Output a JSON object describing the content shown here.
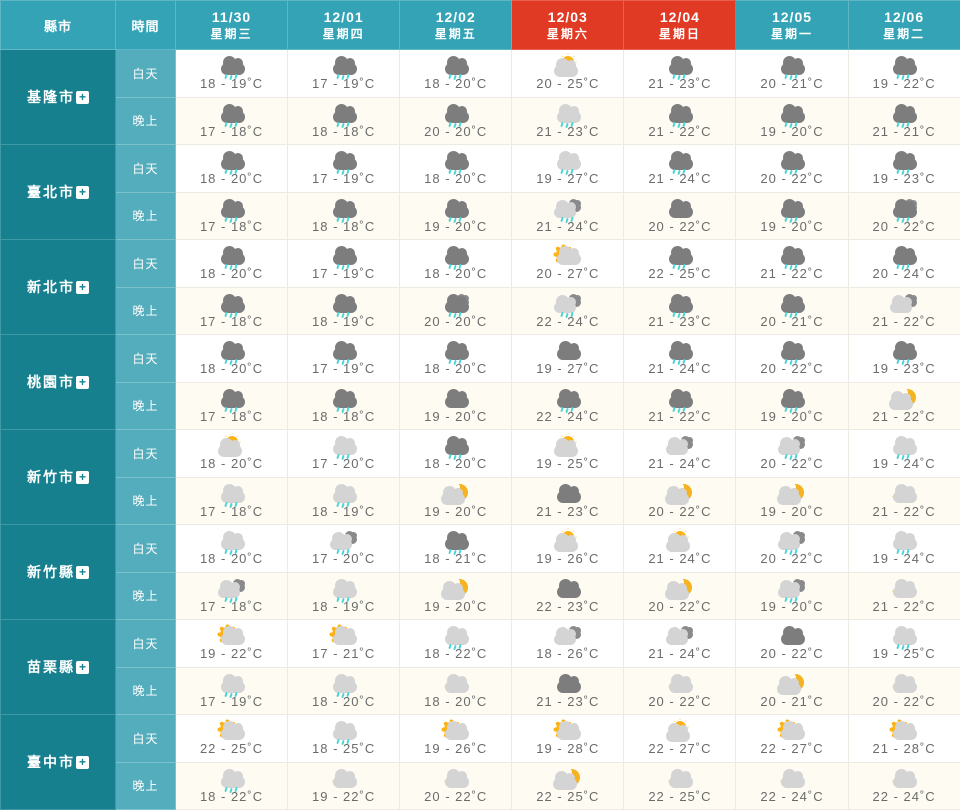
{
  "colors": {
    "header_teal": "#35a3b6",
    "weekend_red": "#e03a25",
    "city_teal": "#17808f",
    "time_teal": "#54adbc",
    "night_row_bg": "#fdfbf2",
    "temp_text": "#6b6b6b",
    "rain_blue": "#4fd3d9",
    "sun_orange": "#fbb315",
    "moon_orange": "#f5b221"
  },
  "header": {
    "city_label": "縣市",
    "time_label": "時間",
    "days": [
      {
        "date": "11/30",
        "dow": "星期三",
        "weekend": false
      },
      {
        "date": "12/01",
        "dow": "星期四",
        "weekend": false
      },
      {
        "date": "12/02",
        "dow": "星期五",
        "weekend": false
      },
      {
        "date": "12/03",
        "dow": "星期六",
        "weekend": true
      },
      {
        "date": "12/04",
        "dow": "星期日",
        "weekend": true
      },
      {
        "date": "12/05",
        "dow": "星期一",
        "weekend": false
      },
      {
        "date": "12/06",
        "dow": "星期二",
        "weekend": false
      }
    ]
  },
  "labels": {
    "day": "白天",
    "night": "晚上",
    "expand_icon": "+"
  },
  "rows": [
    {
      "city": "基隆市",
      "day": {
        "icons": [
          "rain",
          "rain",
          "rain",
          "sun-behind-cloud",
          "rain",
          "rain",
          "rain"
        ],
        "temps": [
          "18 - 19˚C",
          "17 - 19˚C",
          "18 - 20˚C",
          "20 - 25˚C",
          "21 - 23˚C",
          "20 - 21˚C",
          "19 - 22˚C"
        ]
      },
      "night": {
        "icons": [
          "rain",
          "rain",
          "rain",
          "light-rain",
          "rain",
          "rain",
          "rain"
        ],
        "temps": [
          "17 - 18˚C",
          "18 - 18˚C",
          "20 - 20˚C",
          "21 - 23˚C",
          "21 - 22˚C",
          "19 - 20˚C",
          "21 - 21˚C"
        ]
      }
    },
    {
      "city": "臺北市",
      "day": {
        "icons": [
          "rain",
          "rain",
          "rain",
          "light-rain",
          "rain",
          "rain",
          "rain"
        ],
        "temps": [
          "18 - 20˚C",
          "17 - 19˚C",
          "18 - 20˚C",
          "19 - 27˚C",
          "21 - 24˚C",
          "20 - 22˚C",
          "19 - 23˚C"
        ]
      },
      "night": {
        "icons": [
          "rain",
          "rain",
          "rain",
          "light-rain-cloud",
          "cloud",
          "rain",
          "rain-cloud"
        ],
        "temps": [
          "17 - 18˚C",
          "18 - 18˚C",
          "19 - 20˚C",
          "21 - 24˚C",
          "20 - 22˚C",
          "19 - 20˚C",
          "20 - 22˚C"
        ]
      }
    },
    {
      "city": "新北市",
      "day": {
        "icons": [
          "rain",
          "rain",
          "rain",
          "sun",
          "rain",
          "rain",
          "rain"
        ],
        "temps": [
          "18 - 20˚C",
          "17 - 19˚C",
          "18 - 20˚C",
          "20 - 27˚C",
          "22 - 25˚C",
          "21 - 22˚C",
          "20 - 24˚C"
        ]
      },
      "night": {
        "icons": [
          "rain",
          "rain",
          "rain-cloud",
          "light-rain-cloud",
          "rain",
          "rain",
          "cloud-light"
        ],
        "temps": [
          "17 - 18˚C",
          "18 - 19˚C",
          "20 - 20˚C",
          "22 - 24˚C",
          "21 - 23˚C",
          "20 - 21˚C",
          "21 - 22˚C"
        ]
      }
    },
    {
      "city": "桃園市",
      "day": {
        "icons": [
          "rain",
          "rain",
          "rain",
          "cloud",
          "rain",
          "rain",
          "rain"
        ],
        "temps": [
          "18 - 20˚C",
          "17 - 19˚C",
          "18 - 20˚C",
          "19 - 27˚C",
          "21 - 24˚C",
          "20 - 22˚C",
          "19 - 23˚C"
        ]
      },
      "night": {
        "icons": [
          "rain",
          "rain",
          "cloud",
          "rain",
          "rain",
          "rain",
          "moon-behind-cloud"
        ],
        "temps": [
          "17 - 18˚C",
          "18 - 18˚C",
          "19 - 20˚C",
          "22 - 24˚C",
          "21 - 22˚C",
          "19 - 20˚C",
          "21 - 22˚C"
        ]
      }
    },
    {
      "city": "新竹市",
      "day": {
        "icons": [
          "sun-behind-cloud",
          "light-rain",
          "rain",
          "sun-behind-cloud",
          "cloud-light",
          "light-rain-cloud",
          "light-rain"
        ],
        "temps": [
          "18 - 20˚C",
          "17 - 20˚C",
          "18 - 20˚C",
          "19 - 25˚C",
          "21 - 24˚C",
          "20 - 22˚C",
          "19 - 24˚C"
        ]
      },
      "night": {
        "icons": [
          "light-rain",
          "light-rain",
          "moon-behind-cloud",
          "cloud",
          "moon-behind-cloud",
          "moon-behind-cloud",
          "moon"
        ],
        "temps": [
          "17 - 18˚C",
          "18 - 19˚C",
          "19 - 20˚C",
          "21 - 23˚C",
          "20 - 22˚C",
          "19 - 20˚C",
          "21 - 22˚C"
        ]
      }
    },
    {
      "city": "新竹縣",
      "day": {
        "icons": [
          "light-rain",
          "light-rain-cloud",
          "rain",
          "sun-behind-cloud",
          "sun-behind-cloud",
          "light-rain-cloud",
          "light-rain"
        ],
        "temps": [
          "18 - 20˚C",
          "17 - 20˚C",
          "18 - 21˚C",
          "19 - 26˚C",
          "21 - 24˚C",
          "20 - 22˚C",
          "19 - 24˚C"
        ]
      },
      "night": {
        "icons": [
          "light-rain-cloud",
          "light-rain",
          "moon-behind-cloud",
          "cloud",
          "moon-behind-cloud",
          "light-rain-cloud",
          "moon"
        ],
        "temps": [
          "17 - 18˚C",
          "18 - 19˚C",
          "19 - 20˚C",
          "22 - 23˚C",
          "20 - 22˚C",
          "19 - 20˚C",
          "21 - 22˚C"
        ]
      }
    },
    {
      "city": "苗栗縣",
      "day": {
        "icons": [
          "sun",
          "sun",
          "light-rain",
          "cloud-light",
          "cloud-light",
          "cloud",
          "light-rain"
        ],
        "temps": [
          "19 - 22˚C",
          "17 - 21˚C",
          "18 - 22˚C",
          "18 - 26˚C",
          "21 - 24˚C",
          "20 - 22˚C",
          "19 - 25˚C"
        ]
      },
      "night": {
        "icons": [
          "light-rain",
          "light-rain",
          "moon",
          "cloud",
          "moon",
          "moon-behind-cloud",
          "moon"
        ],
        "temps": [
          "17 - 19˚C",
          "18 - 20˚C",
          "18 - 20˚C",
          "21 - 23˚C",
          "20 - 22˚C",
          "20 - 21˚C",
          "20 - 22˚C"
        ]
      }
    },
    {
      "city": "臺中市",
      "day": {
        "icons": [
          "sun",
          "light-rain",
          "sun",
          "sun",
          "sun-behind-cloud",
          "sun",
          "sun"
        ],
        "temps": [
          "22 - 25˚C",
          "18 - 25˚C",
          "19 - 26˚C",
          "19 - 28˚C",
          "22 - 27˚C",
          "22 - 27˚C",
          "21 - 28˚C"
        ]
      },
      "night": {
        "icons": [
          "light-rain",
          "moon",
          "moon",
          "moon-behind-cloud",
          "moon",
          "moon",
          "moon"
        ],
        "temps": [
          "18 - 22˚C",
          "19 - 22˚C",
          "20 - 22˚C",
          "22 - 25˚C",
          "22 - 25˚C",
          "22 - 24˚C",
          "22 - 24˚C"
        ]
      }
    }
  ]
}
